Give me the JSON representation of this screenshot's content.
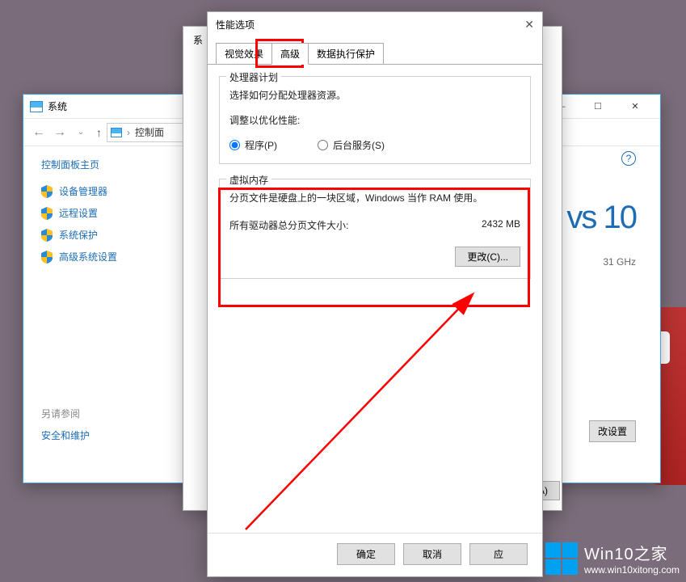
{
  "system_window": {
    "title": "系统",
    "breadcrumb": "控制面",
    "cp_home": "控制面板主页",
    "sidebar_links": [
      "设备管理器",
      "远程设置",
      "系统保护",
      "高级系统设置"
    ],
    "seealso_title": "另请参阅",
    "seealso_link": "安全和维护",
    "right_cpu": "31 GHz",
    "right_change": "改设置",
    "win_text": "vs 10",
    "controls": {
      "min": "—",
      "max": "☐",
      "close": "✕"
    }
  },
  "sysprops_window": {
    "title": "系",
    "apply": "应",
    "bottom_label": "A)"
  },
  "perf_window": {
    "title": "性能选项",
    "close": "✕",
    "tabs": [
      "视觉效果",
      "高级",
      "数据执行保护"
    ],
    "proc_group": {
      "title": "处理器计划",
      "desc": "选择如何分配处理器资源。",
      "adjust_label": "调整以优化性能:",
      "radio1": "程序(P)",
      "radio2": "后台服务(S)"
    },
    "vm_group": {
      "title": "虚拟内存",
      "desc": "分页文件是硬盘上的一块区域，Windows 当作 RAM 使用。",
      "total_label": "所有驱动器总分页文件大小:",
      "total_value": "2432 MB",
      "change_btn": "更改(C)..."
    },
    "buttons": {
      "ok": "确定",
      "cancel": "取消",
      "apply": "应"
    }
  },
  "watermark": {
    "brand": "Win10之家",
    "url": "www.win10xitong.com"
  }
}
